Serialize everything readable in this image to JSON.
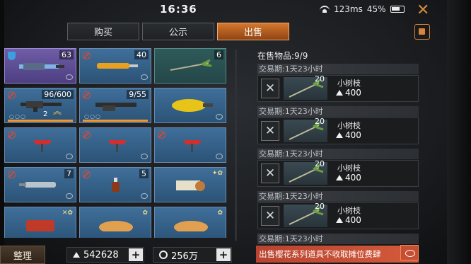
{
  "status": {
    "time": "16:36",
    "network": "123ms",
    "battery": "45%"
  },
  "tabs": [
    {
      "label": "购买",
      "active": false
    },
    {
      "label": "公示",
      "active": false
    },
    {
      "label": "出售",
      "active": true
    }
  ],
  "grid": [
    {
      "badge": "63"
    },
    {
      "badge": "40"
    },
    {
      "badge": "6"
    },
    {
      "badge": "96/600",
      "level": "2"
    },
    {
      "badge": "9/55"
    },
    {
      "badge": ""
    },
    {
      "badge": ""
    },
    {
      "badge": ""
    },
    {
      "badge": ""
    },
    {
      "badge": "7"
    },
    {
      "badge": "5"
    },
    {
      "badge": ""
    },
    {
      "badge": ""
    },
    {
      "badge": ""
    },
    {
      "badge": ""
    }
  ],
  "sale_panel": {
    "title": "在售物品:9/9"
  },
  "listings": [
    {
      "period": "交易期:1天23小时",
      "qty": "20",
      "name": "小树枝",
      "price": "400"
    },
    {
      "period": "交易期:1天23小时",
      "qty": "20",
      "name": "小树枝",
      "price": "400"
    },
    {
      "period": "交易期:1天23小时",
      "qty": "20",
      "name": "小树枝",
      "price": "400"
    },
    {
      "period": "交易期:1天23小时",
      "qty": "20",
      "name": "小树枝",
      "price": "400"
    },
    {
      "period": "交易期:1天23小时",
      "qty": "",
      "name": "",
      "price": ""
    }
  ],
  "bottom": {
    "sort_label": "整理",
    "currency1": "542628",
    "currency2": "256万",
    "notice": "出售樱花系列道具不收取摊位费肆"
  },
  "colors": {
    "accent": "#d4782e",
    "cell_blue": "#3f6f9a",
    "cell_purple": "#6f5da6",
    "notice": "#c64f32"
  }
}
